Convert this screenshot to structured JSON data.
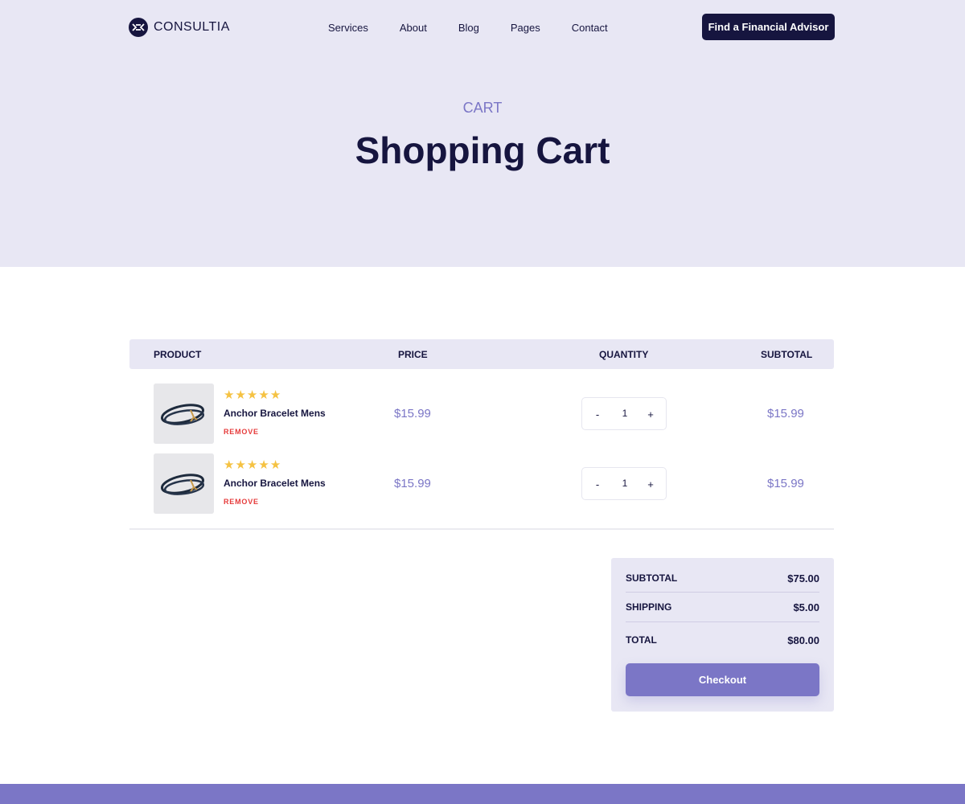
{
  "brand": {
    "name": "CONSULTIA"
  },
  "nav": {
    "items": [
      "Services",
      "About",
      "Blog",
      "Pages",
      "Contact"
    ],
    "cta": "Find a Financial Advisor"
  },
  "hero": {
    "eyebrow": "CART",
    "title": "Shopping Cart"
  },
  "table": {
    "headers": {
      "product": "PRODUCT",
      "price": "PRICE",
      "quantity": "QUANTITY",
      "subtotal": "SUBTOTAL"
    },
    "rows": [
      {
        "name": "Anchor Bracelet Mens",
        "rating": 5,
        "remove": "REMOVE",
        "price": "$15.99",
        "quantity": "1",
        "subtotal": "$15.99"
      },
      {
        "name": "Anchor Bracelet Mens",
        "rating": 5,
        "remove": "REMOVE",
        "price": "$15.99",
        "quantity": "1",
        "subtotal": "$15.99"
      }
    ]
  },
  "totals": {
    "subtotal_label": "SUBTOTAL",
    "subtotal_value": "$75.00",
    "shipping_label": "SHIPPING",
    "shipping_value": "$5.00",
    "total_label": "TOTAL",
    "total_value": "$80.00",
    "checkout": "Checkout"
  },
  "colors": {
    "navy": "#16153f",
    "accent": "#7b76c6",
    "hero_bg": "#e8e7f4",
    "star": "#f5c242",
    "remove": "#e63b3b"
  },
  "icons": {
    "star": "star-icon",
    "minus": "minus-icon",
    "plus": "plus-icon"
  }
}
